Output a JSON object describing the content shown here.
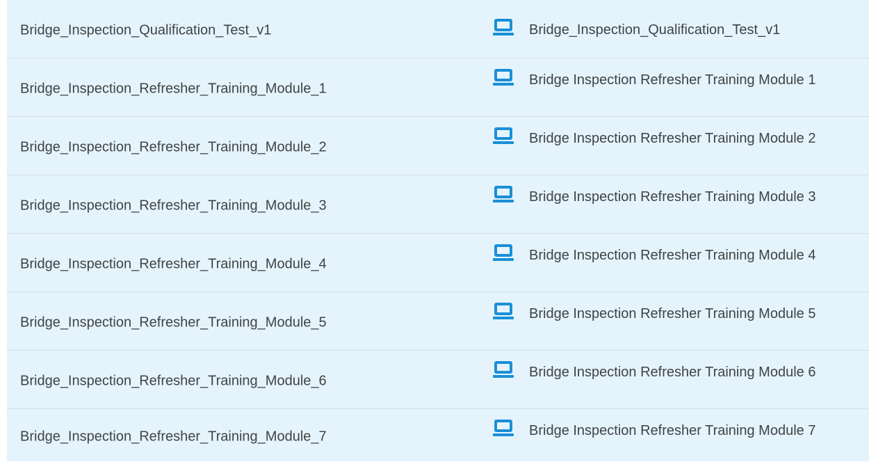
{
  "courses": [
    {
      "name": "Bridge_Inspection_Qualification_Test_v1",
      "title": "Bridge_Inspection_Qualification_Test_v1",
      "icon": "computer-icon"
    },
    {
      "name": "Bridge_Inspection_Refresher_Training_Module_1",
      "title": "Bridge Inspection Refresher Training Module 1",
      "icon": "computer-icon"
    },
    {
      "name": "Bridge_Inspection_Refresher_Training_Module_2",
      "title": "Bridge Inspection Refresher Training Module 2",
      "icon": "computer-icon"
    },
    {
      "name": "Bridge_Inspection_Refresher_Training_Module_3",
      "title": "Bridge Inspection Refresher Training Module 3",
      "icon": "computer-icon"
    },
    {
      "name": "Bridge_Inspection_Refresher_Training_Module_4",
      "title": "Bridge Inspection Refresher Training Module 4",
      "icon": "computer-icon"
    },
    {
      "name": "Bridge_Inspection_Refresher_Training_Module_5",
      "title": "Bridge Inspection Refresher Training Module 5",
      "icon": "computer-icon"
    },
    {
      "name": "Bridge_Inspection_Refresher_Training_Module_6",
      "title": "Bridge Inspection Refresher Training Module 6",
      "icon": "computer-icon"
    },
    {
      "name": "Bridge_Inspection_Refresher_Training_Module_7",
      "title": "Bridge Inspection Refresher Training Module 7",
      "icon": "computer-icon"
    }
  ],
  "colors": {
    "row_background": "#e5f4fc",
    "row_divider": "#d3dde3",
    "text": "#3f4347",
    "icon": "#1a8fd6"
  }
}
